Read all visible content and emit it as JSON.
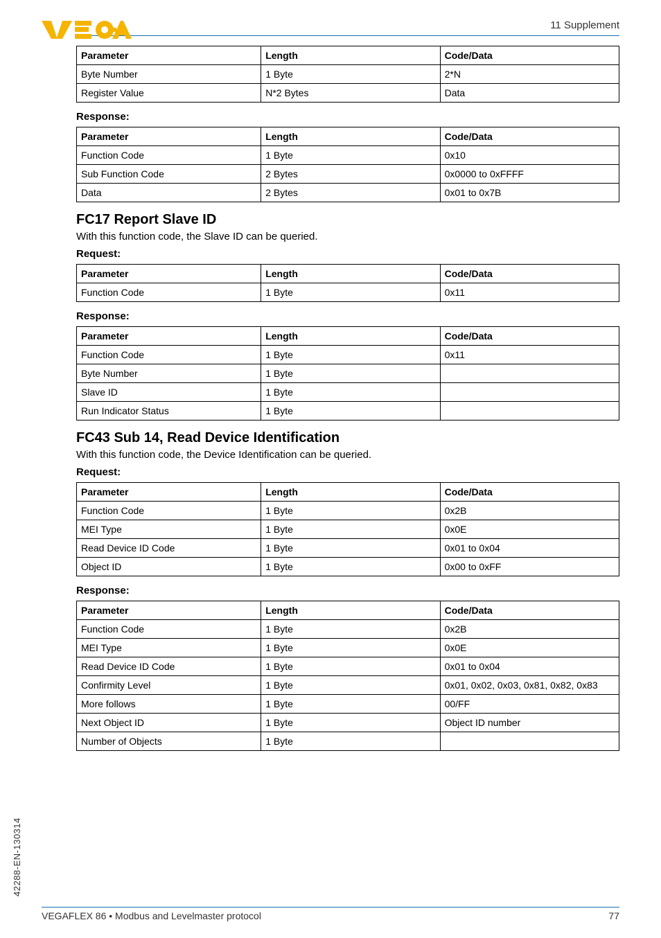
{
  "header": {
    "right": "11 Supplement"
  },
  "sidebar_code": "42288-EN-130314",
  "footer": {
    "left": "VEGAFLEX 86 • Modbus and Levelmaster protocol",
    "right": "77"
  },
  "table1": {
    "head": [
      "Parameter",
      "Length",
      "Code/Data"
    ],
    "rows": [
      [
        "Byte Number",
        "1 Byte",
        "2*N"
      ],
      [
        "Register Value",
        "N*2 Bytes",
        "Data"
      ]
    ]
  },
  "label1": "Response:",
  "table2": {
    "head": [
      "Parameter",
      "Length",
      "Code/Data"
    ],
    "rows": [
      [
        "Function Code",
        "1 Byte",
        "0x10"
      ],
      [
        "Sub Function Code",
        "2 Bytes",
        "0x0000 to 0xFFFF"
      ],
      [
        "Data",
        "2 Bytes",
        "0x01 to 0x7B"
      ]
    ]
  },
  "section_fc17": {
    "title": "FC17 Report Slave ID",
    "desc": "With this function code, the Slave ID can be queried.",
    "label_req": "Request:",
    "table_req": {
      "head": [
        "Parameter",
        "Length",
        "Code/Data"
      ],
      "rows": [
        [
          "Function Code",
          "1 Byte",
          "0x11"
        ]
      ]
    },
    "label_res": "Response:",
    "table_res": {
      "head": [
        "Parameter",
        "Length",
        "Code/Data"
      ],
      "rows": [
        [
          "Function Code",
          "1 Byte",
          "0x11"
        ],
        [
          "Byte Number",
          "1 Byte",
          ""
        ],
        [
          "Slave ID",
          "1 Byte",
          ""
        ],
        [
          "Run Indicator Status",
          "1 Byte",
          ""
        ]
      ]
    }
  },
  "section_fc43": {
    "title": "FC43 Sub 14, Read Device Identification",
    "desc": "With this function code, the Device Identification can be queried.",
    "label_req": "Request:",
    "table_req": {
      "head": [
        "Parameter",
        "Length",
        "Code/Data"
      ],
      "rows": [
        [
          "Function Code",
          "1 Byte",
          "0x2B"
        ],
        [
          "MEI Type",
          "1 Byte",
          "0x0E"
        ],
        [
          "Read Device ID Code",
          "1 Byte",
          "0x01 to 0x04"
        ],
        [
          "Object ID",
          "1 Byte",
          "0x00 to 0xFF"
        ]
      ]
    },
    "label_res": "Response:",
    "table_res": {
      "head": [
        "Parameter",
        "Length",
        "Code/Data"
      ],
      "rows": [
        [
          "Function Code",
          "1 Byte",
          "0x2B"
        ],
        [
          "MEI Type",
          "1 Byte",
          "0x0E"
        ],
        [
          "Read Device ID Code",
          "1 Byte",
          "0x01 to 0x04"
        ],
        [
          "Confirmity Level",
          "1 Byte",
          "0x01, 0x02, 0x03, 0x81, 0x82, 0x83"
        ],
        [
          "More follows",
          "1 Byte",
          "00/FF"
        ],
        [
          "Next Object ID",
          "1 Byte",
          "Object ID number"
        ],
        [
          "Number of Objects",
          "1 Byte",
          ""
        ]
      ]
    }
  }
}
